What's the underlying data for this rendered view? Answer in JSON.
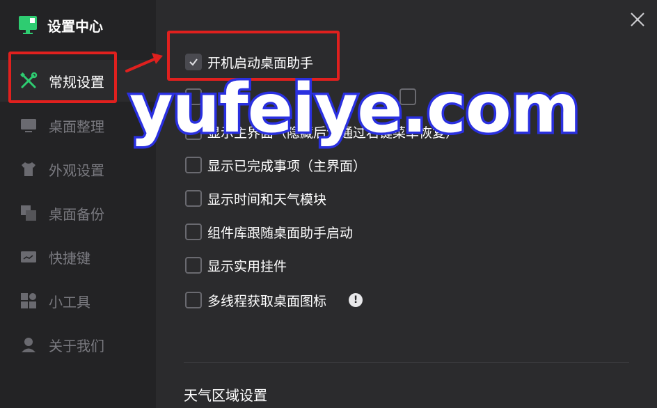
{
  "app": {
    "title": "设置中心"
  },
  "sidebar": {
    "items": [
      {
        "label": "常规设置",
        "icon": "tools-icon",
        "active": true
      },
      {
        "label": "桌面整理",
        "icon": "monitor-icon",
        "active": false
      },
      {
        "label": "外观设置",
        "icon": "shirt-icon",
        "active": false
      },
      {
        "label": "桌面备份",
        "icon": "copy-icon",
        "active": false
      },
      {
        "label": "快捷键",
        "icon": "keyboard-icon",
        "active": false
      },
      {
        "label": "小工具",
        "icon": "grid-icon",
        "active": false
      },
      {
        "label": "关于我们",
        "icon": "user-icon",
        "active": false
      }
    ]
  },
  "options": [
    {
      "label": "开机启动桌面助手",
      "checked": true
    },
    {
      "label": "显示主界面（隐藏后请通过右键菜单恢复）",
      "checked": false
    },
    {
      "label": "显示已完成事项（主界面）",
      "checked": false
    },
    {
      "label": "显示时间和天气模块",
      "checked": false
    },
    {
      "label": "组件库跟随桌面助手启动",
      "checked": false
    },
    {
      "label": "显示实用挂件",
      "checked": false
    },
    {
      "label": "多线程获取桌面图标",
      "checked": false,
      "info": "!"
    }
  ],
  "sections": {
    "weather_title": "天气区域设置"
  },
  "watermark": "yufeiye.com",
  "colors": {
    "accent": "#2ecc71",
    "highlight": "#e0201e",
    "watermark_stroke": "#2a30e0"
  }
}
